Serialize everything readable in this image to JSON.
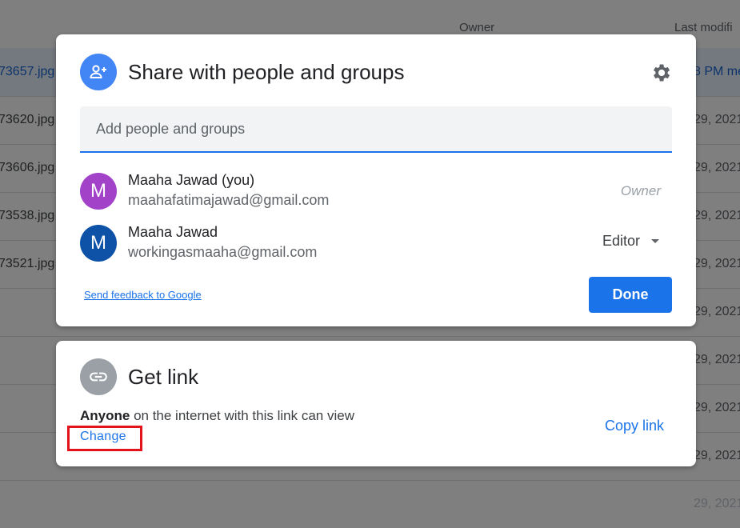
{
  "background": {
    "columns": {
      "owner": "Owner",
      "last_modified": "Last modifi"
    },
    "rows": [
      {
        "file": "73657.jpg",
        "date": "8 PM  me",
        "selected": true
      },
      {
        "file": "73620.jpg",
        "date": "29, 2021"
      },
      {
        "file": "73606.jpg",
        "date": "29, 2021"
      },
      {
        "file": "73538.jpg",
        "date": "29, 2021"
      },
      {
        "file": "73521.jpg",
        "date": "29, 2021"
      },
      {
        "file": "",
        "date": "29, 2021"
      },
      {
        "file": "",
        "date": "29, 2021"
      },
      {
        "file": "",
        "date": "29, 2021"
      },
      {
        "file": "",
        "date": "29, 2021"
      },
      {
        "file": "",
        "date": "29, 2021"
      }
    ]
  },
  "share": {
    "title": "Share with people and groups",
    "add_placeholder": "Add people and groups",
    "people": [
      {
        "initial": "M",
        "name": "Maaha Jawad (you)",
        "email": "maahafatimajawad@gmail.com",
        "role": "Owner",
        "avatar_color": "#a142c8"
      },
      {
        "initial": "M",
        "name": "Maaha Jawad",
        "email": "workingasmaaha@gmail.com",
        "role": "Editor",
        "avatar_color": "#0d52a6"
      }
    ],
    "feedback_label": "Send feedback to Google",
    "done_label": "Done"
  },
  "link": {
    "title": "Get link",
    "desc_bold": "Anyone",
    "desc_rest": " on the internet with this link can view",
    "change_label": "Change",
    "copy_label": "Copy link"
  },
  "colors": {
    "accent": "#1a73e8",
    "highlight_box": "#e3121b"
  }
}
